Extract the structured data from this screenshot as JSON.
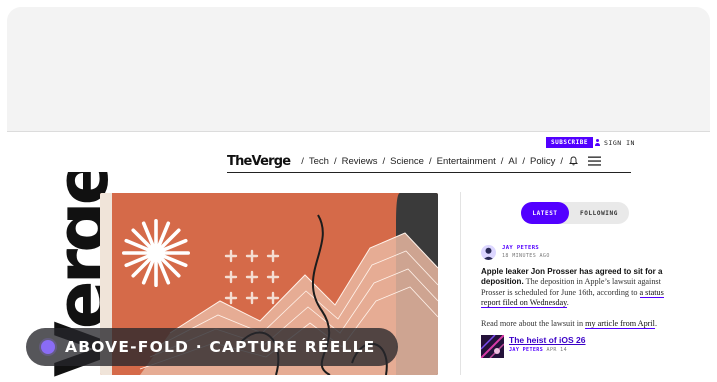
{
  "header": {
    "subscribe_label": "SUBSCRIBE",
    "signin_label": "SIGN IN"
  },
  "nav": {
    "logo": "TheVerge",
    "items": [
      "Tech",
      "Reviews",
      "Science",
      "Entertainment",
      "AI",
      "Policy"
    ],
    "icons": [
      "bell-icon",
      "hamburger-menu-icon"
    ]
  },
  "hero": {
    "wordmark": "Verge",
    "colors": {
      "accent": "#5200ff",
      "hero_bg": "#d56a49",
      "dark": "#3a3a3a"
    }
  },
  "tabs": {
    "active": "LATEST",
    "inactive": "FOLLOWING"
  },
  "feed": {
    "post": {
      "author": "JAY PETERS",
      "time": "18 MINUTES AGO",
      "headline": "Apple leaker Jon Prosser has agreed to sit for a deposition.",
      "body": "The deposition in Apple’s lawsuit against Prosser is scheduled for June 16th, according to",
      "link": "a status report filed on Wednesday",
      "end": ".",
      "more_prefix": "Read more about the lawsuit in",
      "more_link": "my article from April",
      "more_end": "."
    },
    "story": {
      "title": "The heist of iOS 26",
      "author": "JAY PETERS",
      "date": "APR 14"
    }
  },
  "overlay": {
    "label": "ABOVE-FOLD · CAPTURE RÉELLE"
  }
}
